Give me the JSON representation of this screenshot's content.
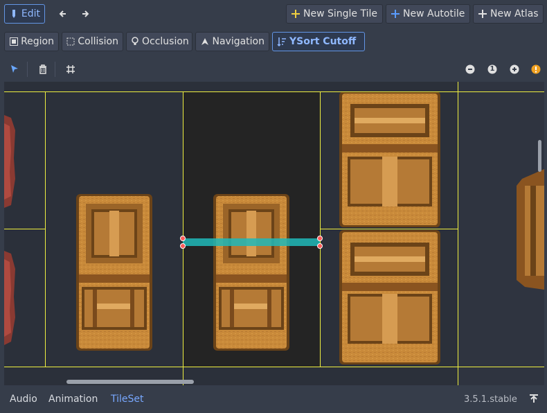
{
  "toolbar": {
    "edit_label": "Edit",
    "new_single_tile_label": "New Single Tile",
    "new_autotile_label": "New Autotile",
    "new_atlas_label": "New Atlas"
  },
  "modes": {
    "region_label": "Region",
    "collision_label": "Collision",
    "occlusion_label": "Occlusion",
    "navigation_label": "Navigation",
    "ysort_label": "YSort Cutoff"
  },
  "zoom": {
    "reset_label": "1"
  },
  "bottom_tabs": {
    "audio": "Audio",
    "animation": "Animation",
    "tileset": "TileSet"
  },
  "status": {
    "version": "3.5.1.stable"
  },
  "colors": {
    "accent": "#78a8ff",
    "grid": "#f0f040",
    "ysort_bar": "#20b8b8",
    "handle": "#ff5a5a",
    "crate": "#c98a3a"
  },
  "icons": [
    "edit-icon",
    "arrow-left-icon",
    "arrow-right-icon",
    "plus-icon",
    "region-icon",
    "collision-icon",
    "occlusion-icon",
    "navigation-icon",
    "ysort-icon",
    "select-icon",
    "trash-icon",
    "grid-icon",
    "zoom-out-icon",
    "zoom-reset-icon",
    "zoom-in-icon",
    "warning-icon",
    "pin-icon"
  ]
}
